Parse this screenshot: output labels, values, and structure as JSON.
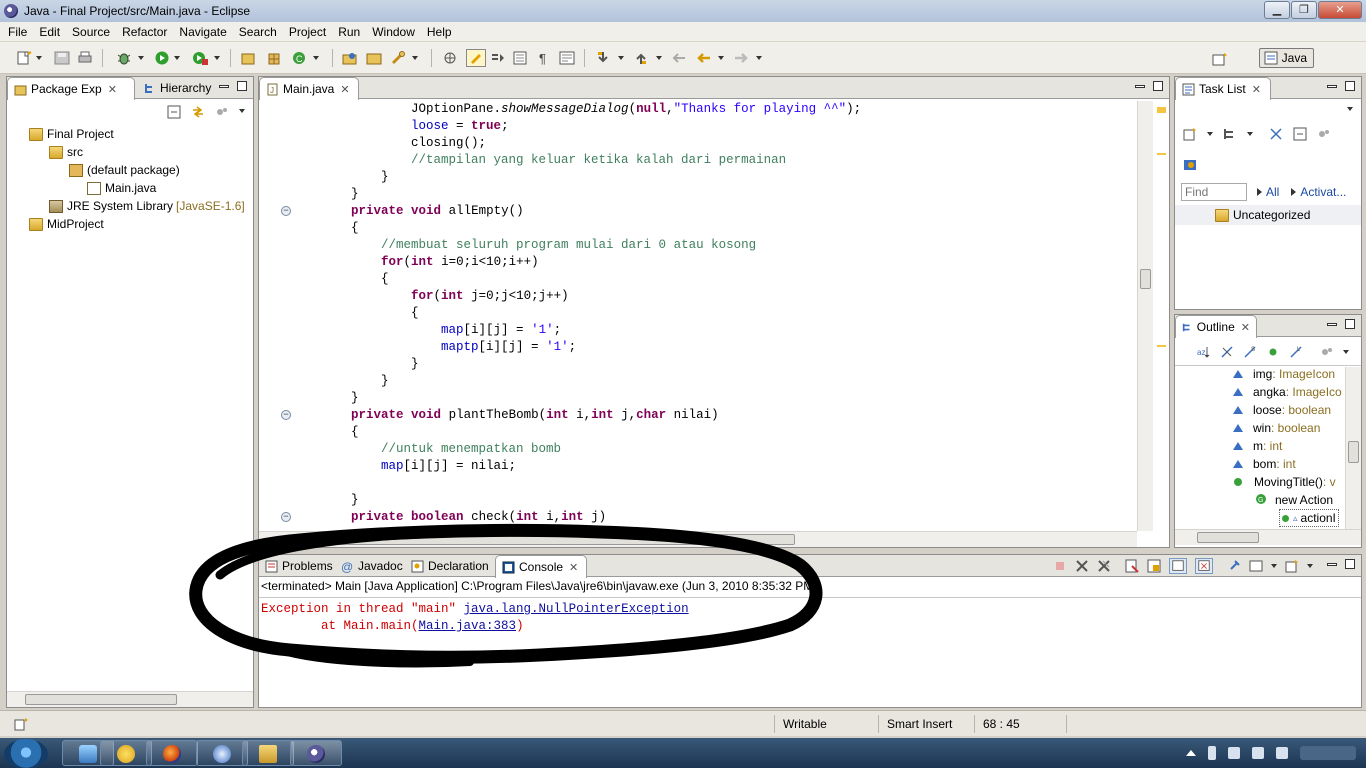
{
  "window": {
    "title": "Java - Final Project/src/Main.java - Eclipse"
  },
  "menu": [
    "File",
    "Edit",
    "Source",
    "Refactor",
    "Navigate",
    "Search",
    "Project",
    "Run",
    "Window",
    "Help"
  ],
  "perspective": {
    "label": "Java"
  },
  "package_explorer": {
    "tabs": [
      {
        "label": "Package Exp"
      },
      {
        "label": "Hierarchy"
      }
    ],
    "tree": [
      {
        "label": "Final Project",
        "decor": ""
      },
      {
        "label": "src",
        "decor": ""
      },
      {
        "label": "(default package)",
        "decor": ""
      },
      {
        "label": "Main.java",
        "decor": ""
      },
      {
        "label": "JRE System Library",
        "decor": "[JavaSE-1.6]"
      },
      {
        "label": "MidProject",
        "decor": ""
      }
    ]
  },
  "editor": {
    "tab": "Main.java",
    "lines": [
      "            JOptionPane.showMessageDialog(null,\"Thanks for playing ^^\");",
      "            loose = true;",
      "            closing();",
      "            //tampilan yang keluar ketika kalah dari permainan",
      "        }",
      "    }",
      "    private void allEmpty()",
      "    {",
      "        //membuat seluruh program mulai dari 0 atau kosong",
      "        for(int i=0;i<10;i++)",
      "        {",
      "            for(int j=0;j<10;j++)",
      "            {",
      "                map[i][j] = '1';",
      "                maptp[i][j] = '1';",
      "            }",
      "        }",
      "    }",
      "    private void plantTheBomb(int i,int j,char nilai)",
      "    {",
      "        //untuk menempatkan bomb",
      "        map[i][j] = nilai;",
      "",
      "    }",
      "    private boolean check(int i,int j)"
    ]
  },
  "console": {
    "tabs": [
      {
        "label": "Problems"
      },
      {
        "label": "Javadoc"
      },
      {
        "label": "Declaration"
      },
      {
        "label": "Console"
      }
    ],
    "header": "<terminated> Main [Java Application] C:\\Program Files\\Java\\jre6\\bin\\javaw.exe (Jun 3, 2010 8:35:32 PM)",
    "exception_prefix": "Exception in thread \"main\" ",
    "exception_link": "java.lang.NullPointerException",
    "trace_prefix": "        at Main.main(",
    "trace_link": "Main.java:383",
    "trace_suffix": ")"
  },
  "task_list": {
    "tab": "Task List",
    "find_placeholder": "Find",
    "all_label": "All",
    "activate_label": "Activat...",
    "category": "Uncategorized"
  },
  "outline": {
    "tab": "Outline",
    "items": [
      {
        "name": "img",
        "type": " : ImageIcon"
      },
      {
        "name": "angka",
        "type": " : ImageIco"
      },
      {
        "name": "loose",
        "type": " : boolean"
      },
      {
        "name": "win",
        "type": " : boolean"
      },
      {
        "name": "m",
        "type": " : int"
      },
      {
        "name": "bom",
        "type": " : int"
      },
      {
        "name": "MovingTitle()",
        "type": " : v"
      },
      {
        "name": "new Action",
        "type": ""
      },
      {
        "name": "actionI",
        "type": ""
      }
    ]
  },
  "status": {
    "writable": "Writable",
    "insert_mode": "Smart Insert",
    "position": "68 : 45"
  },
  "colors": {
    "keyword": "#7f0055",
    "string": "#2a00ff",
    "comment": "#3f7f5f",
    "error": "#d00000"
  }
}
